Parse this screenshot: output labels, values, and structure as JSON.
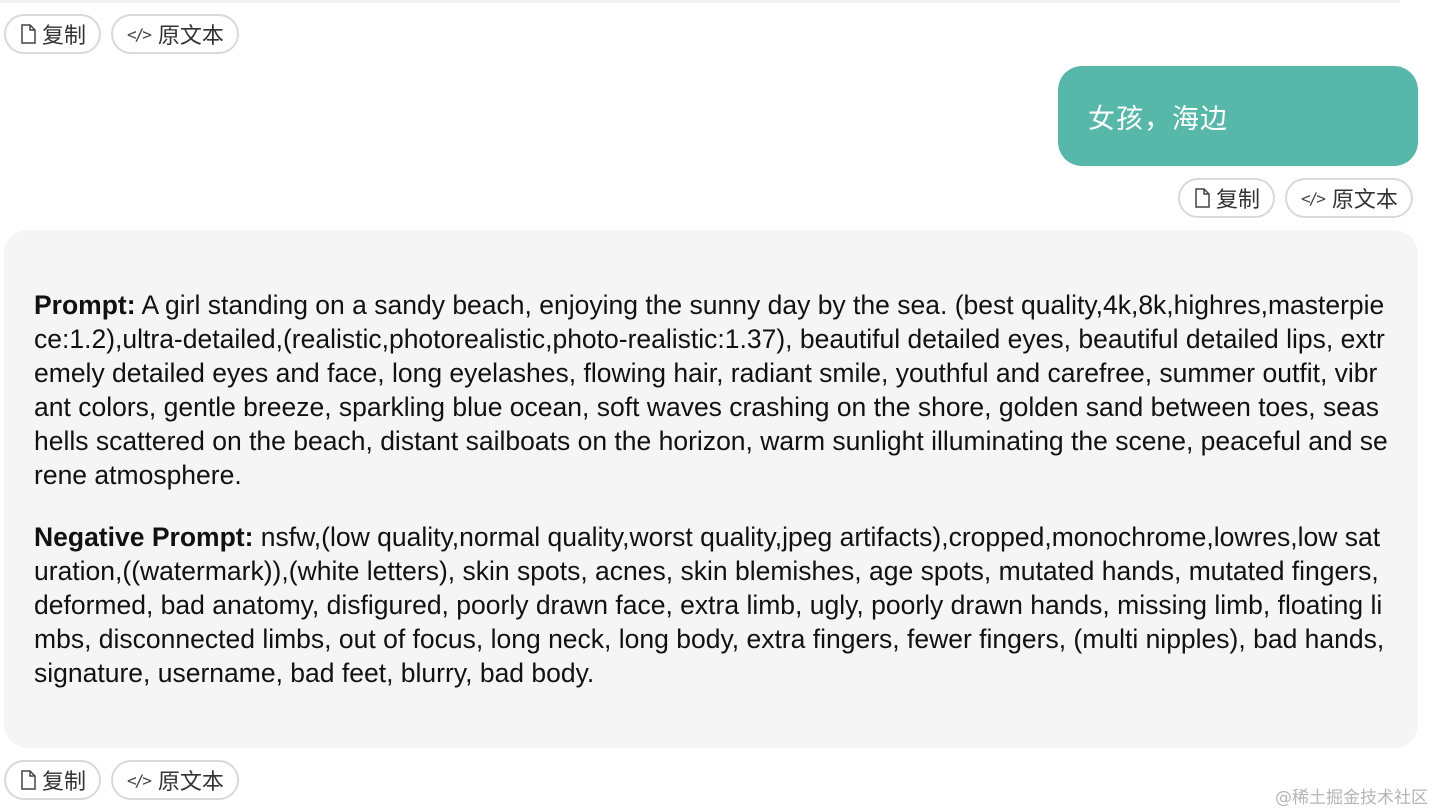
{
  "actions": {
    "copy_label": "复制",
    "raw_label": "原文本",
    "copy_icon": "document-icon",
    "raw_icon": "code-icon"
  },
  "user_message": {
    "text": "女孩，海边"
  },
  "assistant_message": {
    "prompt_label": "Prompt:",
    "prompt_text": " A girl standing on a sandy beach, enjoying the sunny day by the sea. (best quality,4k,8k,highres,masterpiece:1.2),ultra-detailed,(realistic,photorealistic,photo-realistic:1.37), beautiful detailed eyes, beautiful detailed lips, extremely detailed eyes and face, long eyelashes, flowing hair, radiant smile, youthful and carefree, summer outfit, vibrant colors, gentle breeze, sparkling blue ocean, soft waves crashing on the shore, golden sand between toes, seashells scattered on the beach, distant sailboats on the horizon, warm sunlight illuminating the scene, peaceful and serene atmosphere.",
    "negative_label": "Negative Prompt:",
    "negative_text": " nsfw,(low quality,normal quality,worst quality,jpeg artifacts),cropped,monochrome,lowres,low saturation,((watermark)),(white letters), skin spots, acnes, skin blemishes, age spots, mutated hands, mutated fingers, deformed, bad anatomy, disfigured, poorly drawn face, extra limb, ugly, poorly drawn hands, missing limb, floating limbs, disconnected limbs, out of focus, long neck, long body, extra fingers, fewer fingers, (multi nipples), bad hands, signature, username, bad feet, blurry, bad body."
  },
  "watermark": "@稀土掘金技术社区",
  "colors": {
    "user_bubble": "#57b8a9",
    "answer_card": "#f5f5f5",
    "pill_border": "#d9d9d9"
  }
}
